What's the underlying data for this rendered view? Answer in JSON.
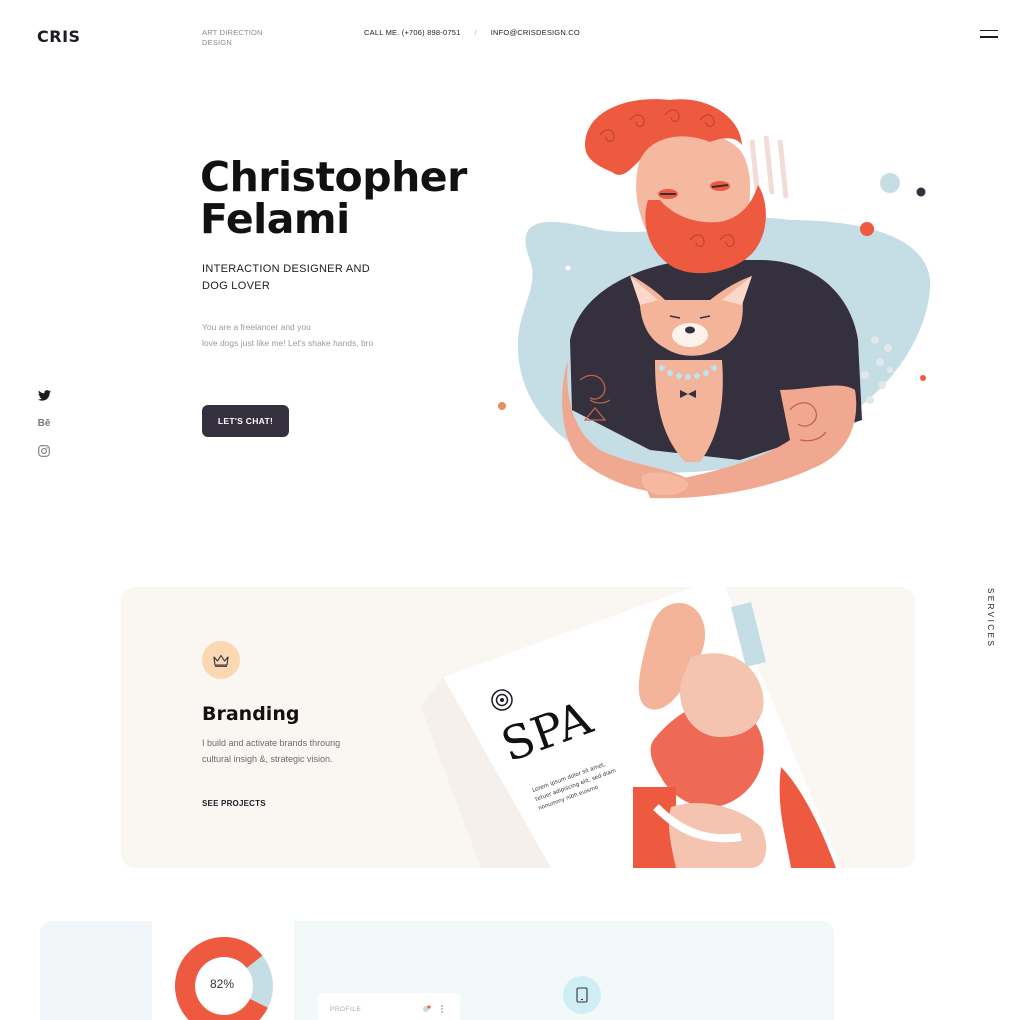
{
  "header": {
    "logo": "CRIS",
    "tagline_line1": "ART DIRECTION",
    "tagline_line2": "DESIGN",
    "phone": "CALL ME.  (+706) 898-0751",
    "separator": "/",
    "email": "INFO@CRISDESIGN.CO",
    "menu_icon": "hamburger-icon"
  },
  "hero": {
    "name_line1": "Christopher",
    "name_line2": "Felami",
    "role_line1": "INTERACTION DESIGNER AND",
    "role_line2": "DOG LOVER",
    "desc_line1": "You are a freelancer and you",
    "desc_line2": "love dogs just like me! Let's shake hands, bro",
    "cta_label": "LET'S CHAT!"
  },
  "social": {
    "items": [
      {
        "icon": "twitter-icon"
      },
      {
        "label": "Bē",
        "icon": "behance-icon"
      },
      {
        "icon": "instagram-icon"
      }
    ]
  },
  "side_label": "SERVICES",
  "services": {
    "branding": {
      "icon": "crown-icon",
      "title": "Branding",
      "desc_line1": "I build and activate brands throung",
      "desc_line2": "cultural insigh &, strategic vision.",
      "link": "SEE PROJECTS",
      "art_title": "SPA",
      "art_caption_line1": "Lorem ipsum dolor sit amet,",
      "art_caption_line2": "tetuer adipiscing elit, sed diam",
      "art_caption_line3": "nonummy nibh euismo"
    }
  },
  "preview": {
    "donut_value": "82%",
    "donut_fraction": 0.82,
    "profile_label": "PROFILE",
    "phone_icon": "phone-icon"
  },
  "colors": {
    "accent": "#ee5a40",
    "dark": "#35303e",
    "blob": "#c5dde4",
    "peach": "#fbd8b2"
  }
}
